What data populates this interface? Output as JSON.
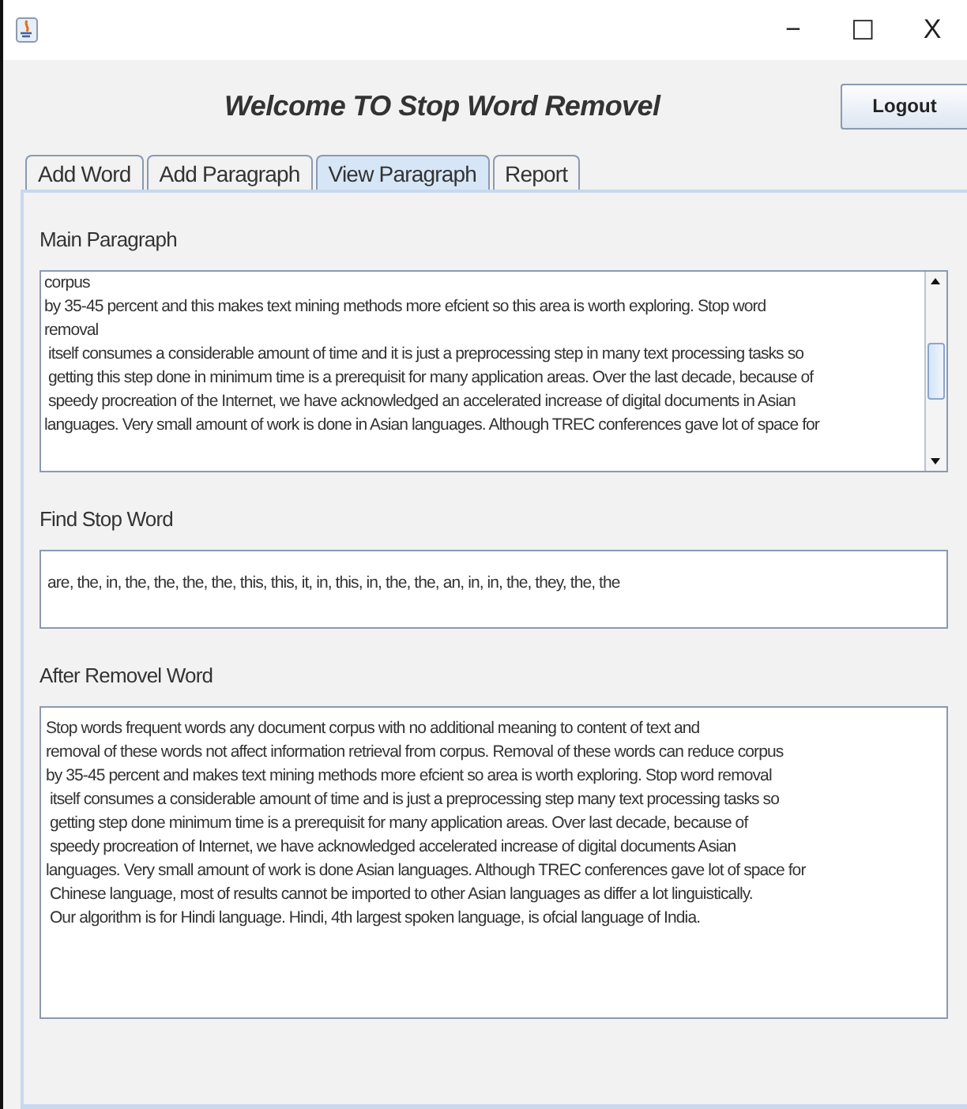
{
  "window": {
    "controls": [
      "−",
      "☐",
      "X"
    ]
  },
  "header": {
    "title": "Welcome TO Stop Word Removel",
    "logout_button": "Logout"
  },
  "tabs": [
    {
      "label": "Add Word",
      "selected": false
    },
    {
      "label": "Add Paragraph",
      "selected": false
    },
    {
      "label": "View Paragraph",
      "selected": true
    },
    {
      "label": "Report",
      "selected": false
    }
  ],
  "main_paragraph": {
    "label": "Main Paragraph",
    "lines": [
      "corpus",
      "by 35-45 percent and this makes text mining methods more efcient so this area is worth exploring. Stop word",
      "removal",
      " itself consumes a considerable amount of time and it is just a preprocessing step in many text processing tasks so",
      " getting this step done in minimum time is a prerequisit for many application areas. Over the last decade, because of",
      " speedy procreation of the Internet, we have acknowledged an accelerated increase of digital documents in Asian",
      "languages. Very small amount of work is done in Asian languages. Although TREC conferences gave lot of space for"
    ]
  },
  "find_stop_word": {
    "label": "Find Stop Word",
    "value": "are, the, in, the, the, the, the, this, this, it, in, this, in, the, the, an, in, in, the, they, the, the"
  },
  "after_removel_word": {
    "label": "After Removel Word",
    "lines": [
      "Stop words frequent words any document corpus with no additional meaning to content of text and",
      "removal of these words not affect information retrieval from corpus. Removal of these words can reduce corpus",
      "by 35-45 percent and makes text mining methods more efcient so area is worth exploring. Stop word removal",
      " itself consumes a considerable amount of time and is just a preprocessing step many text processing tasks so",
      " getting step done minimum time is a prerequisit for many application areas. Over last decade, because of",
      " speedy procreation of Internet, we have acknowledged accelerated increase of digital documents Asian",
      "languages. Very small amount of work is done Asian languages. Although TREC conferences gave lot of space for",
      " Chinese language, most of results cannot be imported to other Asian languages as differ a lot linguistically.",
      " Our algorithm is for Hindi language. Hindi, 4th largest spoken language, is ofcial language of India."
    ]
  }
}
